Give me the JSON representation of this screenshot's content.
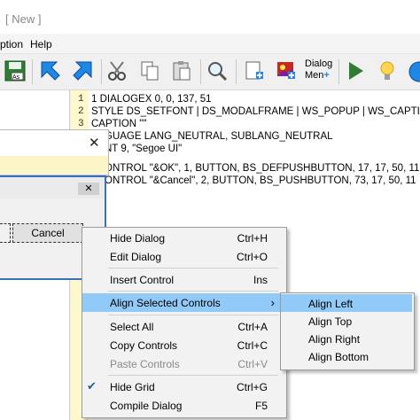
{
  "window": {
    "title": "[ New ]"
  },
  "menubar": {
    "items": [
      {
        "label": "ption"
      },
      {
        "label": "Help"
      }
    ]
  },
  "toolbar": {
    "dialog_label_1": "Dialog",
    "dialog_label_2": "Men"
  },
  "editor": {
    "line_numbers": [
      "1",
      "2",
      "3"
    ],
    "lines": [
      "1 DIALOGEX 0, 0, 137, 51",
      "STYLE DS_SETFONT | DS_MODALFRAME | WS_POPUP | WS_CAPTION |",
      "CAPTION \"\"",
      "GUAGE LANG_NEUTRAL, SUBLANG_NEUTRAL",
      "NT 9, \"Segoe UI\"",
      "ONTROL \"&OK\", 1, BUTTON, BS_DEFPUSHBUTTON, 17, 17, 50, 11",
      "ONTROL \"&Cancel\", 2, BUTTON, BS_PUSHBUTTON, 73, 17, 50, 11"
    ]
  },
  "preview": {
    "close_glyph": "✕",
    "cancel_label": "Cancel"
  },
  "context_menu": {
    "items": [
      {
        "label": "Hide Dialog",
        "shortcut": "Ctrl+H"
      },
      {
        "label": "Edit Dialog",
        "shortcut": "Ctrl+O"
      },
      {
        "label": "Insert Control",
        "shortcut": "Ins"
      },
      {
        "label": "Align Selected Controls",
        "shortcut": "›"
      },
      {
        "label": "Select All",
        "shortcut": "Ctrl+A"
      },
      {
        "label": "Copy Controls",
        "shortcut": "Ctrl+C"
      },
      {
        "label": "Paste Controls",
        "shortcut": "Ctrl+V"
      },
      {
        "label": "Hide Grid",
        "shortcut": "Ctrl+G"
      },
      {
        "label": "Compile Dialog",
        "shortcut": "F5"
      }
    ],
    "check_glyph": "✔"
  },
  "submenu": {
    "items": [
      {
        "label": "Align Left"
      },
      {
        "label": "Align Top"
      },
      {
        "label": "Align Right"
      },
      {
        "label": "Align Bottom"
      }
    ]
  },
  "colors": {
    "highlight": "#91c9f7",
    "gutter": "#fff8cc",
    "dialog_border": "#3b6fb6"
  }
}
